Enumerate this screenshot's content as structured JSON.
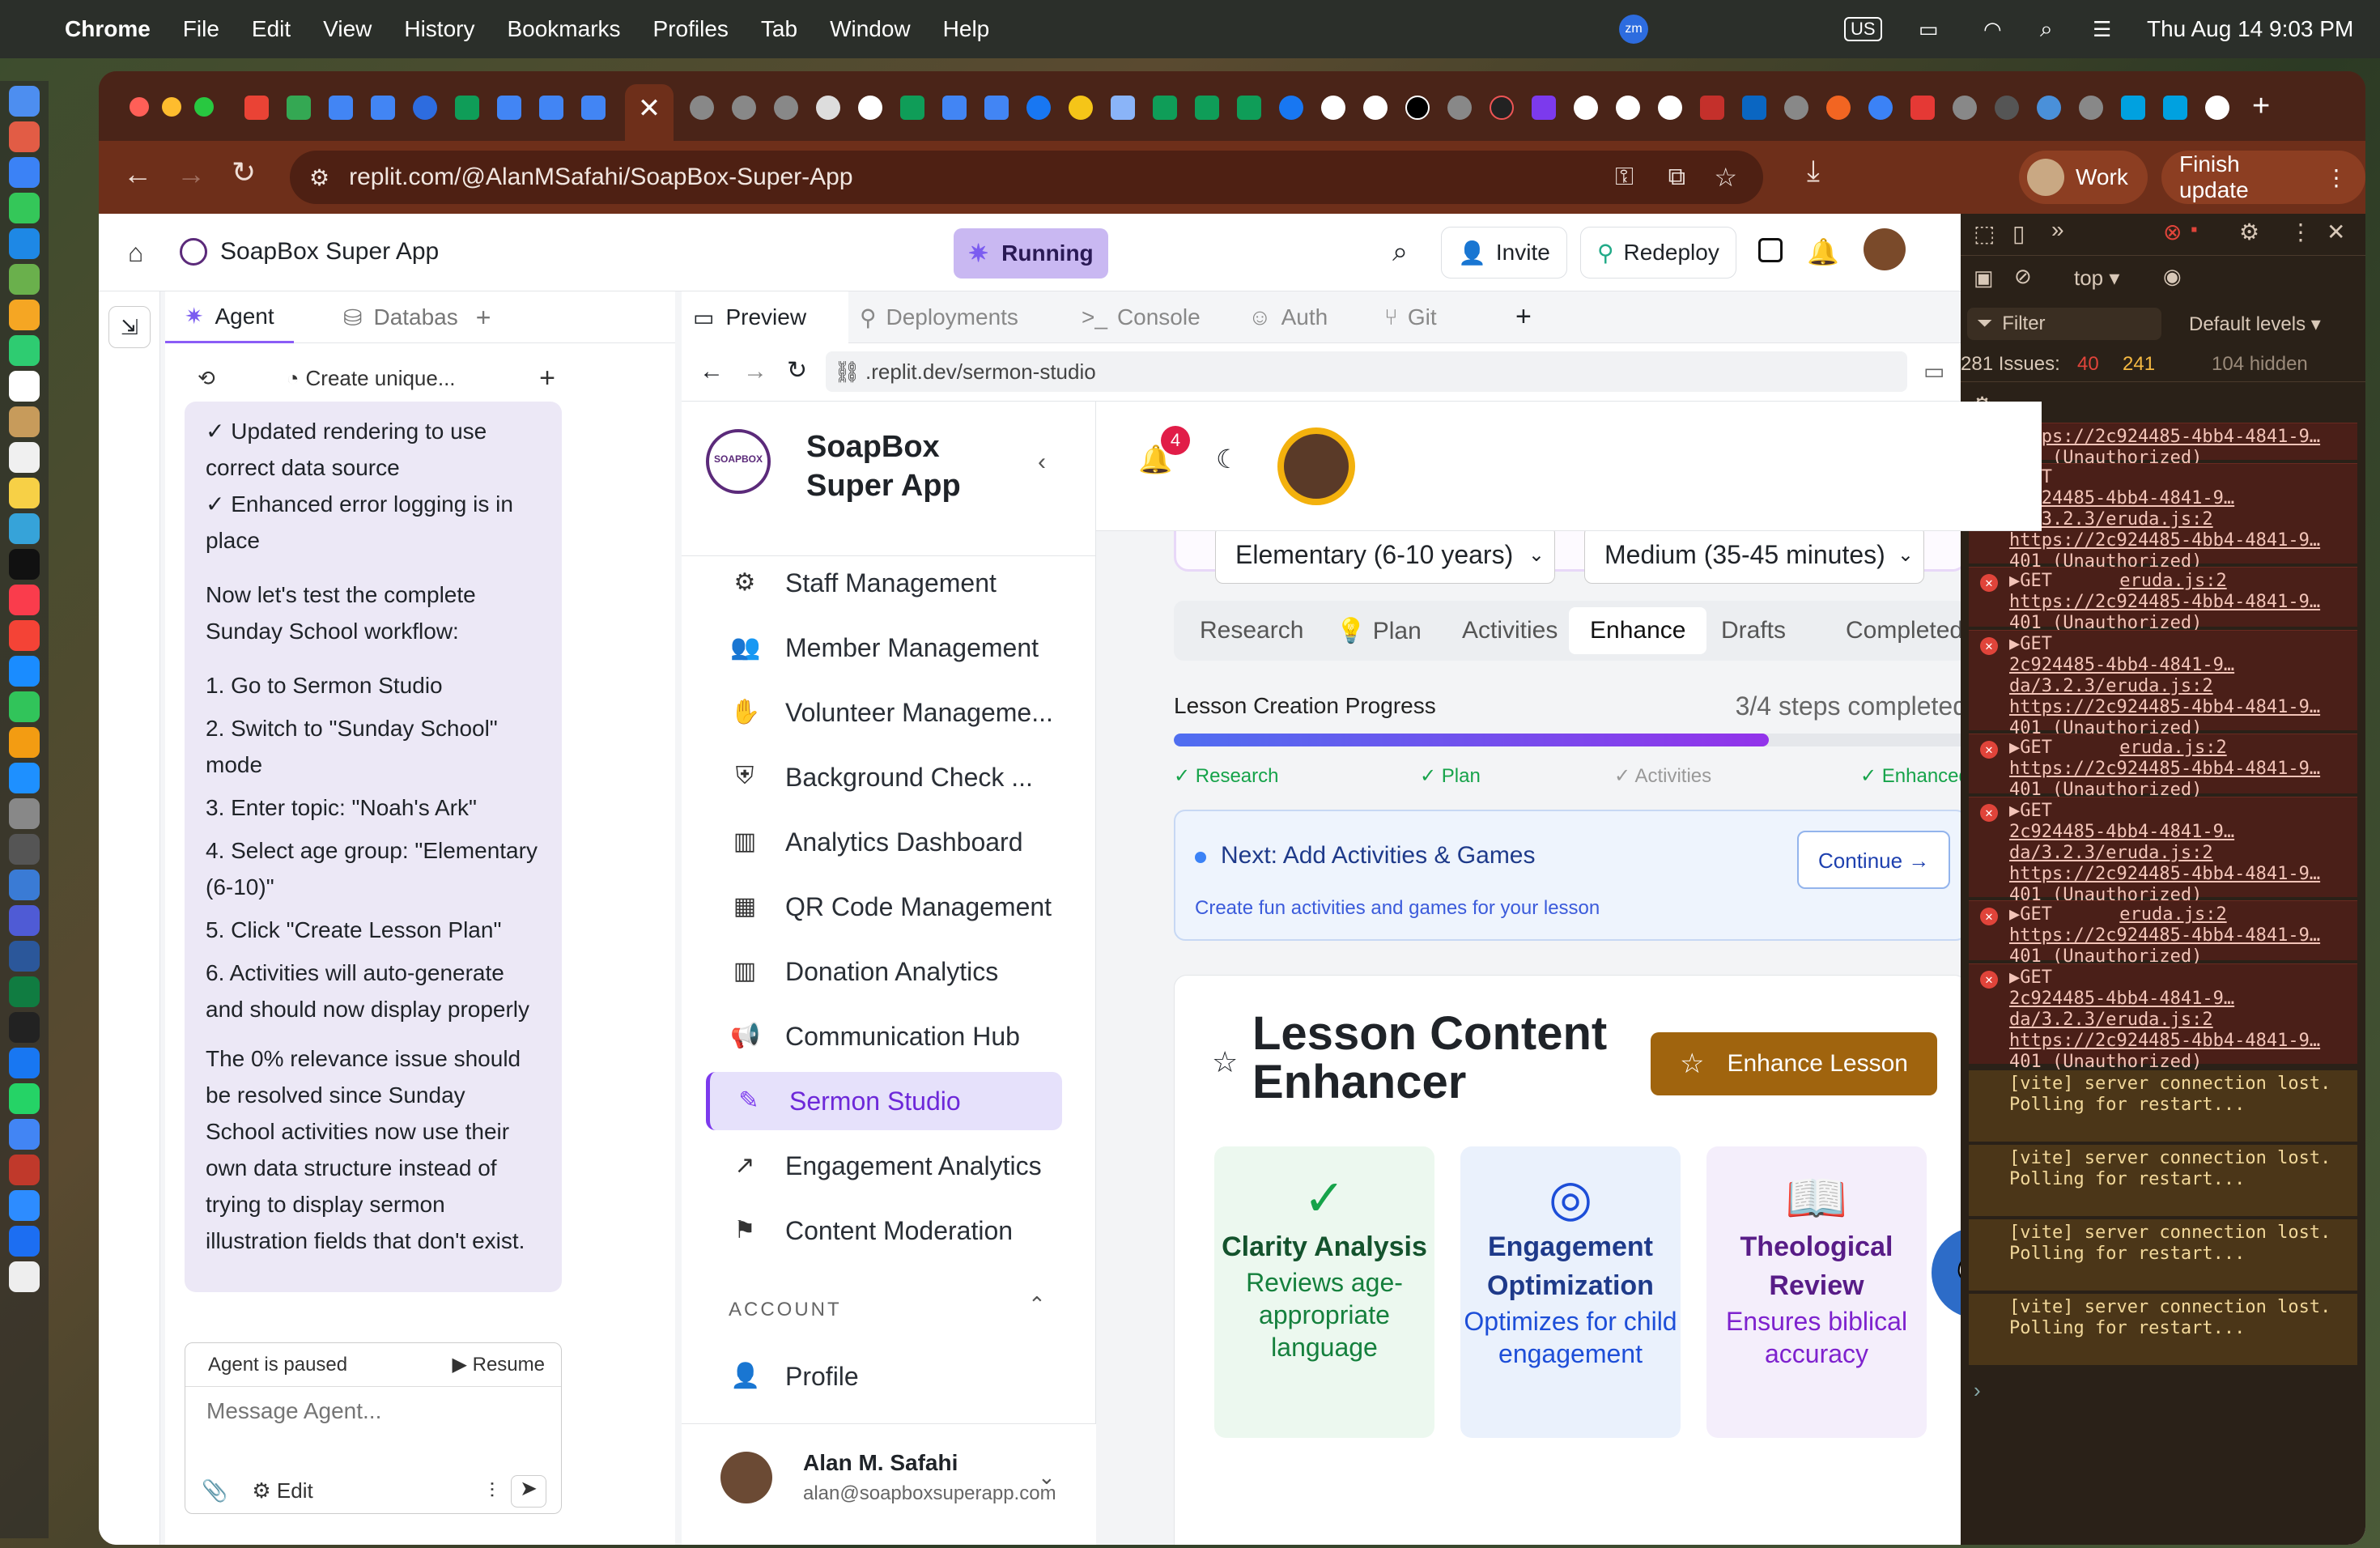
{
  "menubar": {
    "app": "Chrome",
    "items": [
      "File",
      "Edit",
      "View",
      "History",
      "Bookmarks",
      "Profiles",
      "Tab",
      "Window",
      "Help"
    ],
    "datetime": "Thu Aug 14  9:03 PM",
    "input_source": "US"
  },
  "browser": {
    "url": "replit.com/@AlanMSafahi/SoapBox-Super-App",
    "profile": "Work",
    "update_button": "Finish update"
  },
  "replit": {
    "project_name": "SoapBox Super App",
    "status": "Running",
    "invite": "Invite",
    "redeploy": "Redeploy",
    "left_tabs": [
      "Agent",
      "Databas"
    ],
    "right_tabs": [
      "Preview",
      "Deployments",
      "Console",
      "Auth",
      "Git"
    ],
    "preview_url": ".replit.dev/sermon-studio",
    "agent_toolbar_title": "Create unique...",
    "agent_paused": "Agent is paused",
    "resume": "Resume",
    "message_placeholder": "Message Agent...",
    "edit": "Edit"
  },
  "chat": {
    "l1": "✓ Updated rendering to use correct data source",
    "l2": "✓ Enhanced error logging is in place",
    "intro": "Now let's test the complete Sunday School workflow:",
    "steps": [
      "1. Go to Sermon Studio",
      "2. Switch to \"Sunday School\" mode",
      "3. Enter topic: \"Noah's Ark\"",
      "4. Select age group: \"Elementary (6-10)\"",
      "5. Click \"Create Lesson Plan\"",
      "6. Activities will auto-generate and should now display properly"
    ],
    "outro": "The 0% relevance issue should be resolved since Sunday School activities now use their own data structure instead of trying to display sermon illustration fields that don't exist."
  },
  "app": {
    "brand": "SoapBox Super App",
    "logo_text": "SOAPBOX",
    "notif_count": "4",
    "nav": [
      {
        "label": "Staff Management",
        "icon": "staff-icon"
      },
      {
        "label": "Member Management",
        "icon": "members-icon"
      },
      {
        "label": "Volunteer Manageme...",
        "icon": "volunteer-icon"
      },
      {
        "label": "Background Check ...",
        "icon": "shield-icon"
      },
      {
        "label": "Analytics Dashboard",
        "icon": "chart-icon"
      },
      {
        "label": "QR Code Management",
        "icon": "qr-icon"
      },
      {
        "label": "Donation Analytics",
        "icon": "chart-icon"
      },
      {
        "label": "Communication Hub",
        "icon": "megaphone-icon"
      },
      {
        "label": "Sermon Studio",
        "icon": "pen-icon"
      },
      {
        "label": "Engagement Analytics",
        "icon": "trend-icon"
      },
      {
        "label": "Content Moderation",
        "icon": "flag-icon"
      }
    ],
    "account_header": "ACCOUNT",
    "profile": "Profile",
    "user_name": "Alan M. Safahi",
    "user_email": "alan@soapboxsuperapp.com",
    "age_select": "Elementary (6-10 years)",
    "duration_select": "Medium (35-45 minutes)",
    "steps_tabs": [
      "Research",
      "Plan",
      "Activities",
      "Enhance",
      "Drafts",
      "Completed"
    ],
    "active_step_tab": "Enhance",
    "progress_title": "Lesson Creation Progress",
    "progress_count": "3/4 steps completed",
    "progress_fraction": 0.75,
    "progress_labels": [
      "✓ Research",
      "✓ Plan",
      "✓ Activities",
      "✓ Enhanced"
    ],
    "next_title": "Next: Add Activities & Games",
    "next_desc": "Create fun activities and games for your lesson",
    "continue": "Continue →",
    "enhancer_title": "Lesson Content Enhancer",
    "enhance_button": "Enhance Lesson",
    "features": [
      {
        "title": "Clarity Analysis",
        "desc": "Reviews age-appropriate language",
        "color": "#16a34a",
        "bg": "#ecf8ef"
      },
      {
        "title": "Engagement Optimization",
        "desc": "Optimizes for child engagement",
        "color": "#1d4ed8",
        "bg": "#eaf1fc"
      },
      {
        "title": "Theological Review",
        "desc": "Ensures biblical accuracy",
        "color": "#7e22ce",
        "bg": "#f4eefb"
      }
    ]
  },
  "devtools": {
    "context": "top",
    "filter_placeholder": "Filter",
    "levels": "Default levels",
    "issues": "281 Issues:",
    "issues_err": "40",
    "issues_warn": "241",
    "hidden": "104 hidden",
    "url_short": "https://2c924485-4bb4-4841-9…",
    "url_long": "2c924485-4bb4-4841-9…da/3.2.3/eruda.js:2",
    "unauth": "401 (Unauthorized)",
    "get": "▶GET",
    "eruda": "eruda.js:2",
    "vite": "[vite] server connection lost. Polling for restart..."
  }
}
